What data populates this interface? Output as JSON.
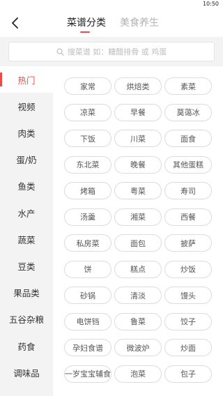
{
  "status_bar": {
    "time": "10:50"
  },
  "header": {
    "tabs": [
      {
        "label": "菜谱分类",
        "active": true
      },
      {
        "label": "美食养生",
        "active": false
      }
    ]
  },
  "search": {
    "placeholder": "搜菜谱 如：糖醋排骨 或 鸡蛋",
    "icon": "search-icon"
  },
  "sidebar": {
    "items": [
      {
        "label": "热门",
        "active": true
      },
      {
        "label": "视频"
      },
      {
        "label": "肉类"
      },
      {
        "label": "蛋/奶"
      },
      {
        "label": "鱼类"
      },
      {
        "label": "水产"
      },
      {
        "label": "蔬菜"
      },
      {
        "label": "豆类"
      },
      {
        "label": "果品类"
      },
      {
        "label": "五谷杂粮"
      },
      {
        "label": "药食"
      },
      {
        "label": "调味品"
      }
    ]
  },
  "categories": [
    "家常",
    "烘焙类",
    "素菜",
    "凉菜",
    "早餐",
    "莫蔼冰",
    "下饭",
    "川菜",
    "面食",
    "东北菜",
    "晚餐",
    "其他蛋糕",
    "烤箱",
    "粤菜",
    "寿司",
    "汤羹",
    "湘菜",
    "西餐",
    "私房菜",
    "面包",
    "披萨",
    "饼",
    "糕点",
    "炒饭",
    "砂锅",
    "清淡",
    "馒头",
    "电饼铛",
    "鲁菜",
    "饺子",
    "孕妇食谱",
    "微波炉",
    "炒面",
    "一岁宝宝辅食",
    "泡菜",
    "包子"
  ],
  "colors": {
    "accent": "#e94b4b",
    "sidebar_bg": "#f3f3f3",
    "chip_border": "#dcdcdc"
  }
}
